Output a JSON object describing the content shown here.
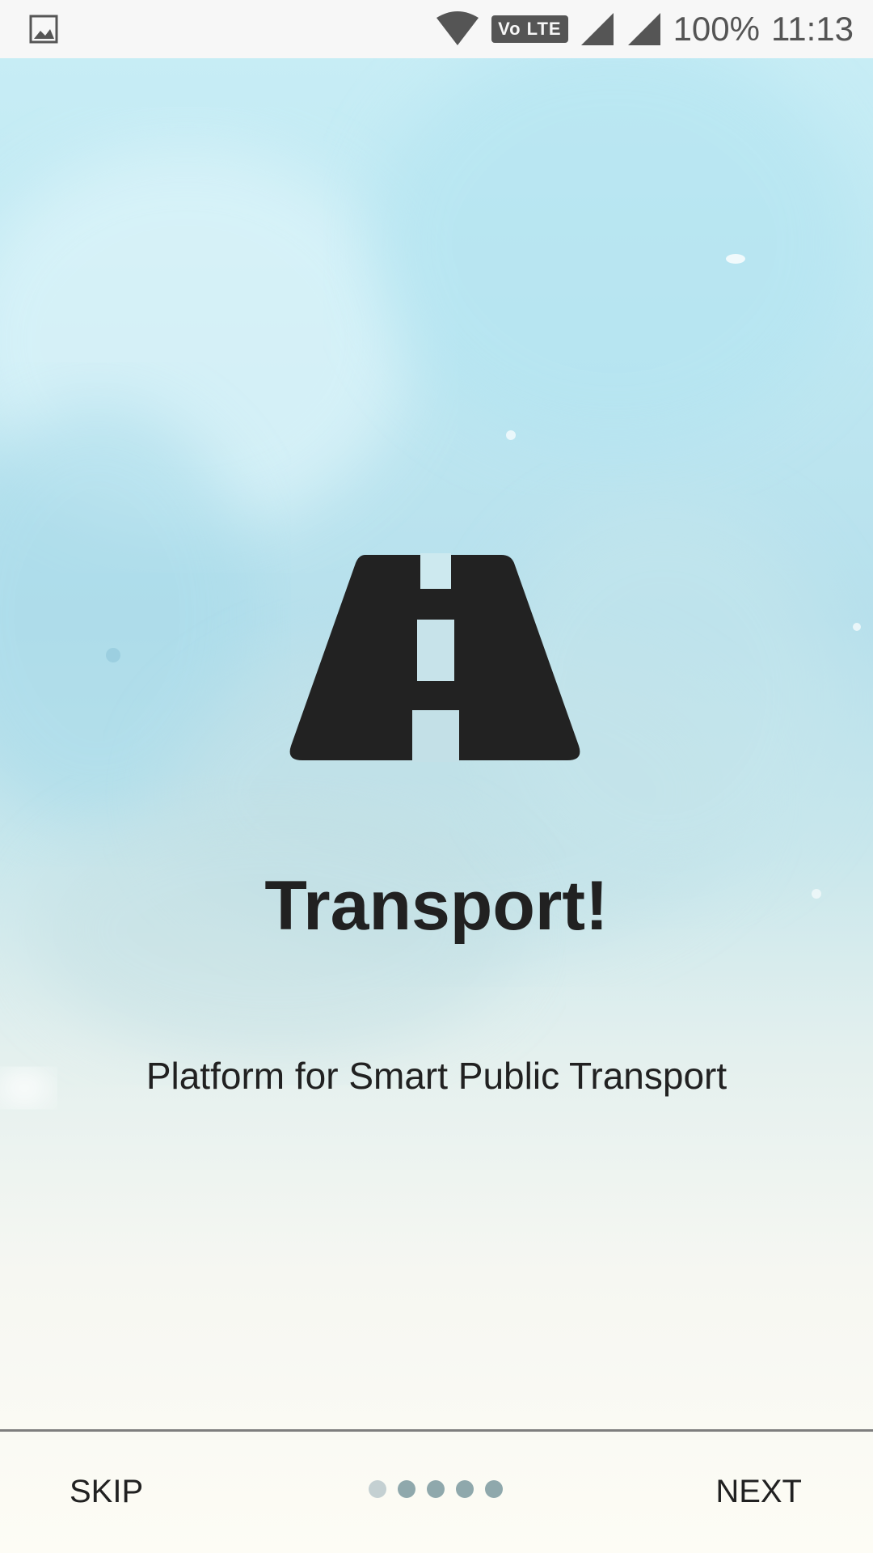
{
  "status_bar": {
    "battery_text": "100%",
    "time": "11:13",
    "network_badge": "Vo LTE",
    "icons": [
      "image-icon",
      "wifi-icon",
      "volte-icon",
      "signal-icon",
      "signal-icon",
      "battery-text"
    ]
  },
  "onboarding": {
    "logo_icon": "road-icon",
    "title": "Transport!",
    "subtitle": "Platform for Smart Public Transport"
  },
  "navigation": {
    "skip_label": "SKIP",
    "next_label": "NEXT",
    "page_count": 5,
    "current_page": 1
  },
  "colors": {
    "text": "#212121",
    "status_icons": "#555555",
    "dot_active": "#c4d0d2",
    "dot_inactive": "#8fa8ac",
    "divider": "#7e7e7e"
  }
}
